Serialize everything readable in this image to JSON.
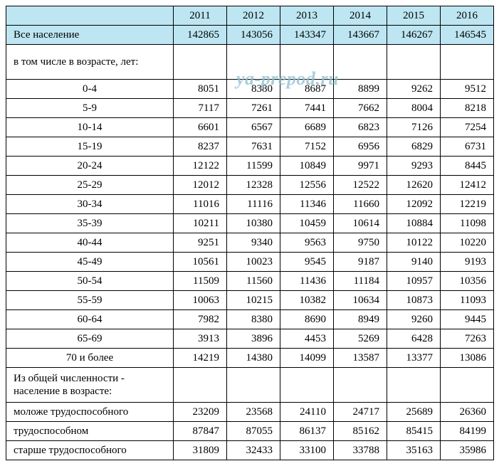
{
  "watermark": "ya-prepod.ru",
  "years": [
    "2011",
    "2012",
    "2013",
    "2014",
    "2015",
    "2016"
  ],
  "total_label": "Все население",
  "total": [
    "142865",
    "143056",
    "143347",
    "143667",
    "146267",
    "146545"
  ],
  "age_header": "  в том числе в возрасте, лет:",
  "age_rows": [
    {
      "label": "0-4",
      "v": [
        "8051",
        "8380",
        "8687",
        "8899",
        "9262",
        "9512"
      ]
    },
    {
      "label": "5-9",
      "v": [
        "7117",
        "7261",
        "7441",
        "7662",
        "8004",
        "8218"
      ]
    },
    {
      "label": "10-14",
      "v": [
        "6601",
        "6567",
        "6689",
        "6823",
        "7126",
        "7254"
      ]
    },
    {
      "label": "15-19",
      "v": [
        "8237",
        "7631",
        "7152",
        "6956",
        "6829",
        "6731"
      ]
    },
    {
      "label": "20-24",
      "v": [
        "12122",
        "11599",
        "10849",
        "9971",
        "9293",
        "8445"
      ]
    },
    {
      "label": "25-29",
      "v": [
        "12012",
        "12328",
        "12556",
        "12522",
        "12620",
        "12412"
      ]
    },
    {
      "label": "30-34",
      "v": [
        "11016",
        "11116",
        "11346",
        "11660",
        "12092",
        "12219"
      ]
    },
    {
      "label": "35-39",
      "v": [
        "10211",
        "10380",
        "10459",
        "10614",
        "10884",
        "11098"
      ]
    },
    {
      "label": "40-44",
      "v": [
        "9251",
        "9340",
        "9563",
        "9750",
        "10122",
        "10220"
      ]
    },
    {
      "label": "45-49",
      "v": [
        "10561",
        "10023",
        "9545",
        "9187",
        "9140",
        "9193"
      ]
    },
    {
      "label": "50-54",
      "v": [
        "11509",
        "11560",
        "11436",
        "11184",
        "10957",
        "10356"
      ]
    },
    {
      "label": "55-59",
      "v": [
        "10063",
        "10215",
        "10382",
        "10634",
        "10873",
        "11093"
      ]
    },
    {
      "label": "60-64",
      "v": [
        "7982",
        "8380",
        "8690",
        "8949",
        "9260",
        "9445"
      ]
    },
    {
      "label": "65-69",
      "v": [
        "3913",
        "3896",
        "4453",
        "5269",
        "6428",
        "7263"
      ]
    },
    {
      "label": "70 и более",
      "v": [
        "14219",
        "14380",
        "14099",
        "13587",
        "13377",
        "13086"
      ]
    }
  ],
  "group_header": "Из общей численности - население в возрасте:",
  "group_rows": [
    {
      "label": " моложе трудоспособного",
      "v": [
        "23209",
        "23568",
        "24110",
        "24717",
        "25689",
        "26360"
      ]
    },
    {
      "label": " трудоспособном",
      "v": [
        "87847",
        "87055",
        "86137",
        "85162",
        "85415",
        "84199"
      ]
    },
    {
      "label": " старше трудоспособного",
      "v": [
        "31809",
        "32433",
        "33100",
        "33788",
        "35163",
        "35986"
      ]
    }
  ]
}
